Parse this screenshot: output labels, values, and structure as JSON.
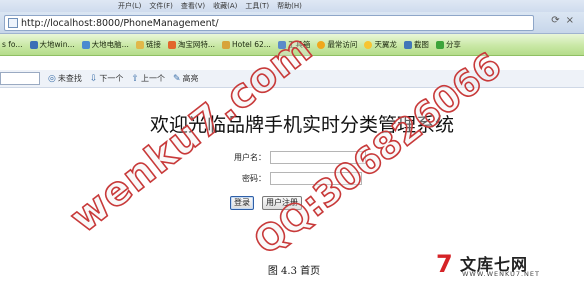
{
  "browser": {
    "menu": [
      "开户(L)",
      "文件(F)",
      "查看(V)",
      "收藏(A)",
      "工具(T)",
      "帮助(H)"
    ],
    "url": "http://localhost:8000/PhoneManagement/",
    "favorites": [
      "s fo...",
      "大地win...",
      "大地电脑...",
      "链接",
      "淘宝网特...",
      "Hotel 62...",
      "工具箱",
      "最常访问",
      "天翼龙",
      "截图",
      "分享"
    ],
    "find": {
      "value": "",
      "not_found": "未查找",
      "next": "下一个",
      "prev": "上一个",
      "highlight": "高亮"
    }
  },
  "page": {
    "title": "欢迎光临品牌手机实时分类管理系统",
    "username_label": "用户名：",
    "username_value": "",
    "password_label": "密码：",
    "password_value": "",
    "login_button": "登录",
    "register_button": "用户注册"
  },
  "caption": "图 4.3    首页",
  "logo": {
    "mark": "7",
    "name": "文库七网",
    "url": "WWW.WENKU7.NET"
  },
  "watermarks": [
    "wenku7.com",
    "QQ:306826066"
  ],
  "colors": {
    "favbar": "#c9e8a6",
    "watermark": "#c83a3a",
    "logo_red": "#d52327"
  }
}
